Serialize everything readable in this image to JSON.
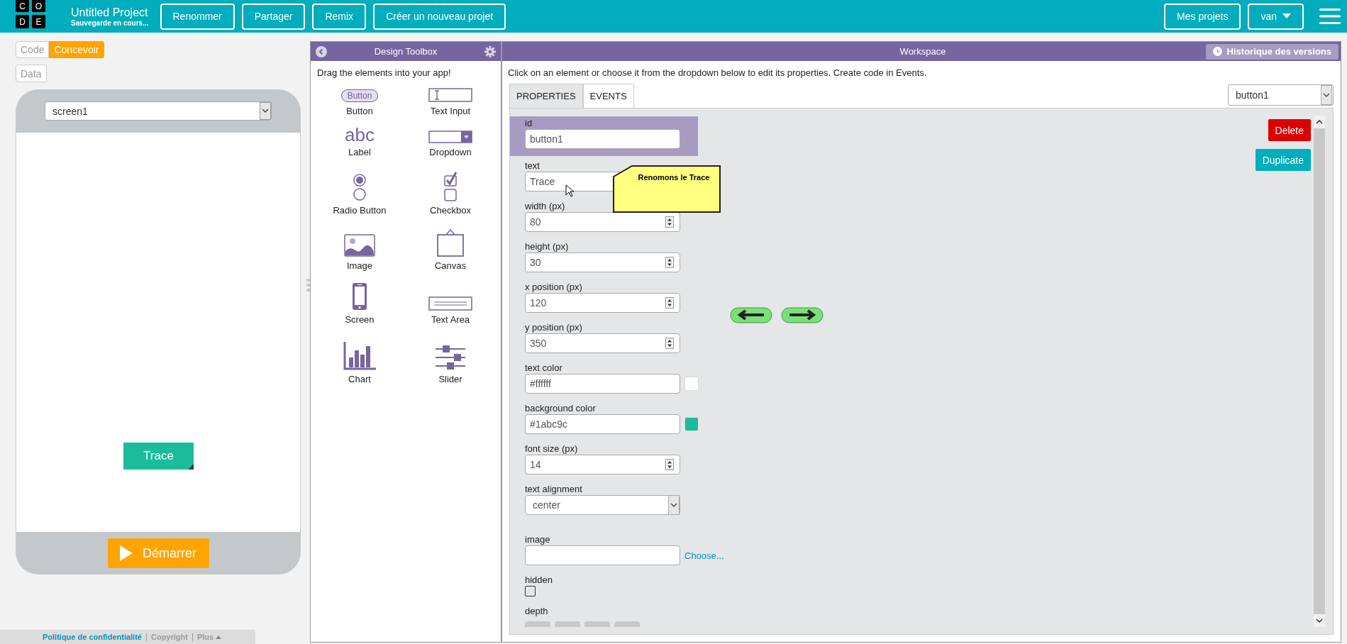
{
  "top_bar": {
    "logo_letters": [
      "C",
      "O",
      "D",
      "E"
    ],
    "project_title": "Untitled Project",
    "save_status": "Sauvegarde en cours...",
    "buttons": [
      "Renommer",
      "Partager",
      "Remix",
      "Créer un nouveau projet"
    ],
    "my_projects": "Mes projets",
    "user_menu": "van"
  },
  "mode_toggle": [
    {
      "label": "Code",
      "selected": false
    },
    {
      "label": "Concevoir",
      "selected": true
    }
  ],
  "data_button": "Data",
  "app_preview": {
    "screen_select": "screen1",
    "elements": [
      {
        "kind": "button",
        "text": "Trace"
      }
    ],
    "run_button": "Démarrer"
  },
  "footer": [
    {
      "kind": "link",
      "text": "Politique de confidentialité"
    },
    {
      "kind": "plain",
      "text": "Copyright"
    },
    {
      "kind": "menu",
      "text": "Plus"
    }
  ],
  "toolbox": {
    "title": "Design Toolbox",
    "hint": "Drag the elements into your app!",
    "items": [
      {
        "kind": "button",
        "label": "Button",
        "icon_text": "Button"
      },
      {
        "kind": "text_input",
        "label": "Text Input"
      },
      {
        "kind": "label",
        "label": "Label",
        "icon_text": "abc"
      },
      {
        "kind": "dropdown",
        "label": "Dropdown"
      },
      {
        "kind": "radio",
        "label": "Radio Button"
      },
      {
        "kind": "checkbox",
        "label": "Checkbox"
      },
      {
        "kind": "image",
        "label": "Image"
      },
      {
        "kind": "canvas",
        "label": "Canvas"
      },
      {
        "kind": "screen",
        "label": "Screen"
      },
      {
        "kind": "text_area",
        "label": "Text Area"
      },
      {
        "kind": "chart",
        "label": "Chart"
      },
      {
        "kind": "slider",
        "label": "Slider"
      }
    ]
  },
  "workspace": {
    "title": "Workspace",
    "history_button": "Historique des versions",
    "instructions": "Click on an element or choose it from the dropdown below to edit its properties. Create code in Events.",
    "tabs": [
      {
        "label": "PROPERTIES",
        "selected": true
      },
      {
        "label": "EVENTS",
        "selected": false
      }
    ],
    "element_select": "button1",
    "properties": [
      {
        "kind": "text",
        "label": "id",
        "value": "button1",
        "highlighted": true
      },
      {
        "kind": "text",
        "label": "text",
        "value": "Trace",
        "highlighted": false
      },
      {
        "kind": "number",
        "label": "width (px)",
        "value": "80",
        "highlighted": false
      },
      {
        "kind": "number",
        "label": "height (px)",
        "value": "30",
        "highlighted": false
      },
      {
        "kind": "number",
        "label": "x position (px)",
        "value": "120",
        "highlighted": false
      },
      {
        "kind": "number",
        "label": "y position (px)",
        "value": "350",
        "highlighted": false
      },
      {
        "kind": "color",
        "label": "text color",
        "value": "#ffffff",
        "color": "#ffffff",
        "highlighted": false
      },
      {
        "kind": "color",
        "label": "background color",
        "value": "#1abc9c",
        "color": "#1abc9c",
        "highlighted": false
      },
      {
        "kind": "number",
        "label": "font size (px)",
        "value": "14",
        "highlighted": false
      },
      {
        "kind": "select",
        "label": "text alignment",
        "value": "center",
        "highlighted": false
      },
      {
        "kind": "image",
        "label": "image",
        "link": "Choose...",
        "highlighted": false
      },
      {
        "kind": "checkbox",
        "label": "hidden",
        "checked": false,
        "highlighted": false
      },
      {
        "kind": "depth",
        "label": "depth",
        "highlighted": false
      }
    ],
    "actions": [
      {
        "kind": "delete",
        "label": "Delete"
      },
      {
        "kind": "duplicate",
        "label": "Duplicate"
      }
    ],
    "arrow_buttons": [
      {
        "kind": "left"
      },
      {
        "kind": "right"
      }
    ],
    "tooltip": "Renomons le Trace"
  }
}
